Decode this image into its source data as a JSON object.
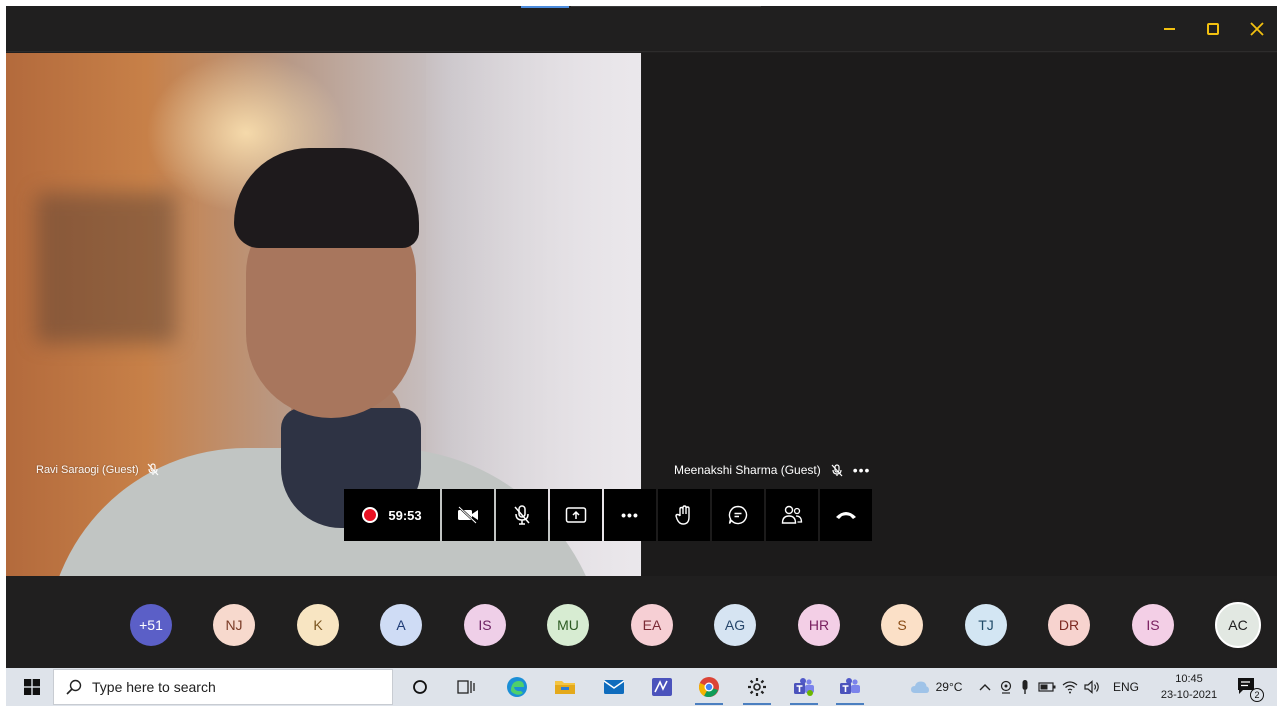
{
  "meeting": {
    "left_participant": "Ravi Saraogi (Guest)",
    "right_participant": "Meenakshi Sharma (Guest)",
    "right_more": "•••",
    "timer": "59:53",
    "more_label": "•••"
  },
  "roster": [
    {
      "initials": "+51",
      "bg": "#5b5fc7",
      "fg": "#ffffff"
    },
    {
      "initials": "NJ",
      "bg": "#f7d9cd",
      "fg": "#7a3b26"
    },
    {
      "initials": "K",
      "bg": "#f8e5c2",
      "fg": "#7a5520"
    },
    {
      "initials": "A",
      "bg": "#cfdcf5",
      "fg": "#1f3b75"
    },
    {
      "initials": "IS",
      "bg": "#efcfe8",
      "fg": "#6e2363"
    },
    {
      "initials": "MU",
      "bg": "#d7ecd2",
      "fg": "#2c5a22"
    },
    {
      "initials": "EA",
      "bg": "#f6cfd4",
      "fg": "#7a2a35"
    },
    {
      "initials": "AG",
      "bg": "#d6e4f2",
      "fg": "#27476b"
    },
    {
      "initials": "HR",
      "bg": "#f3cfe6",
      "fg": "#7a2261"
    },
    {
      "initials": "S",
      "bg": "#fbe0c7",
      "fg": "#8a4d16"
    },
    {
      "initials": "TJ",
      "bg": "#d3e6f3",
      "fg": "#214c69"
    },
    {
      "initials": "DR",
      "bg": "#f7d3cf",
      "fg": "#7d2a22"
    },
    {
      "initials": "IS",
      "bg": "#f3cfe6",
      "fg": "#7a2261"
    },
    {
      "initials": "AC",
      "bg": "#e2e8e2",
      "fg": "#202020"
    }
  ],
  "taskbar": {
    "search_placeholder": "Type here to search",
    "temperature": "29°C",
    "language": "ENG",
    "time": "10:45",
    "date": "23-10-2021",
    "notification_count": "2"
  },
  "colors": {
    "accent_yellow": "#f2c010",
    "record_red": "#e81123",
    "teams_purple": "#5b5fc7"
  }
}
